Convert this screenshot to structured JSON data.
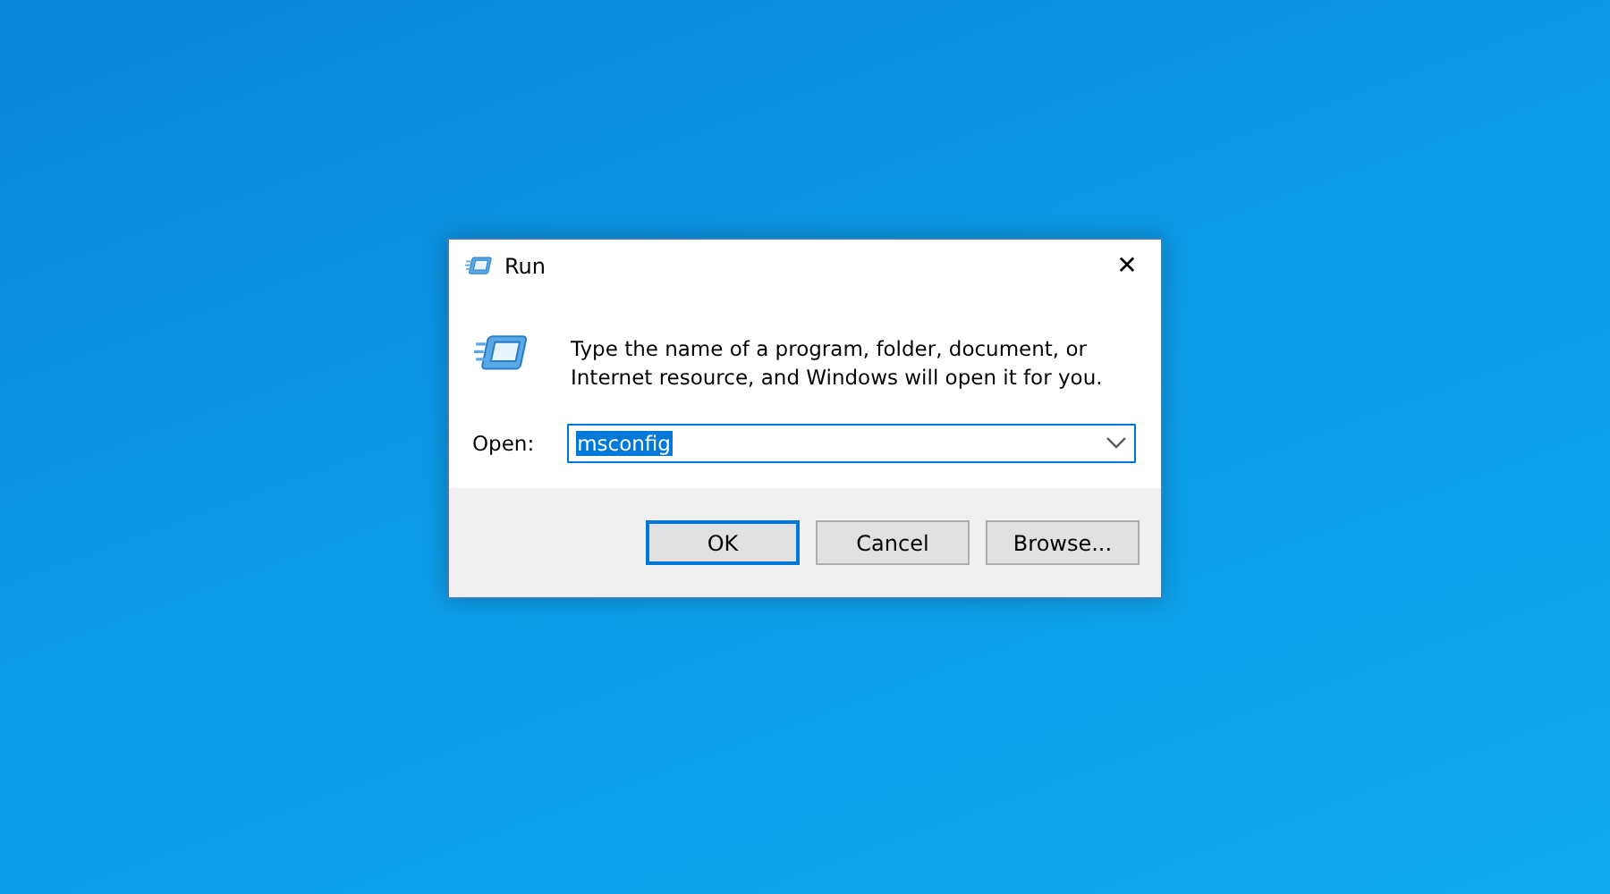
{
  "window": {
    "title": "Run",
    "close": "✕"
  },
  "prompt": "Type the name of a program, folder, document, or Internet resource, and Windows will open it for you.",
  "open_field": {
    "label": "Open:",
    "value": "msconfig",
    "text_selected": true
  },
  "buttons": [
    {
      "label": "OK",
      "default": true
    },
    {
      "label": "Cancel",
      "default": false
    },
    {
      "label": "Browse...",
      "default": false
    }
  ]
}
